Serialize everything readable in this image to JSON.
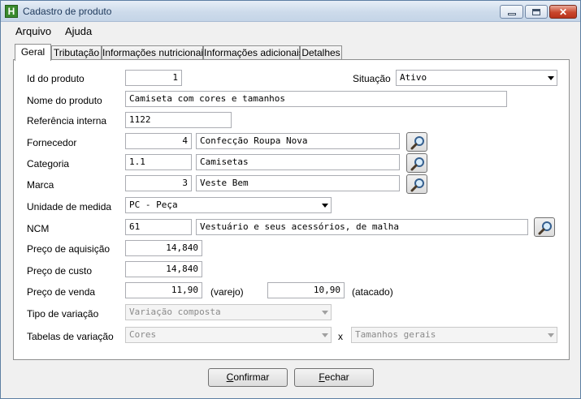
{
  "window": {
    "title": "Cadastro de produto"
  },
  "menu": {
    "arquivo": "Arquivo",
    "ajuda": "Ajuda"
  },
  "tabs": [
    "Geral",
    "Tributação",
    "Informações nutricionais",
    "Informações adicionais",
    "Detalhes"
  ],
  "form": {
    "id_label": "Id do produto",
    "id_value": "1",
    "situacao_label": "Situação",
    "situacao_value": "Ativo",
    "nome_label": "Nome do produto",
    "nome_value": "Camiseta com cores e tamanhos",
    "ref_label": "Referência interna",
    "ref_value": "1122",
    "fornecedor_label": "Fornecedor",
    "fornecedor_code": "4",
    "fornecedor_name": "Confecção Roupa Nova",
    "categoria_label": "Categoria",
    "categoria_code": "1.1",
    "categoria_name": "Camisetas",
    "marca_label": "Marca",
    "marca_code": "3",
    "marca_name": "Veste Bem",
    "unidade_label": "Unidade de medida",
    "unidade_value": "PC - Peça",
    "ncm_label": "NCM",
    "ncm_code": "61",
    "ncm_desc": "Vestuário e seus acessórios, de malha",
    "preco_aquisicao_label": "Preço de aquisição",
    "preco_aquisicao": "14,840",
    "preco_custo_label": "Preço de custo",
    "preco_custo": "14,840",
    "preco_venda_label": "Preço de venda",
    "preco_varejo": "11,90",
    "varejo_label": "(varejo)",
    "preco_atacado": "10,90",
    "atacado_label": "(atacado)",
    "tipo_variacao_label": "Tipo de variação",
    "tipo_variacao": "Variação composta",
    "tabelas_variacao_label": "Tabelas de variação",
    "tabela1": "Cores",
    "x_label": "x",
    "tabela2": "Tamanhos gerais"
  },
  "buttons": {
    "confirmar_first": "C",
    "confirmar_rest": "onfirmar",
    "fechar_first": "F",
    "fechar_rest": "echar"
  }
}
